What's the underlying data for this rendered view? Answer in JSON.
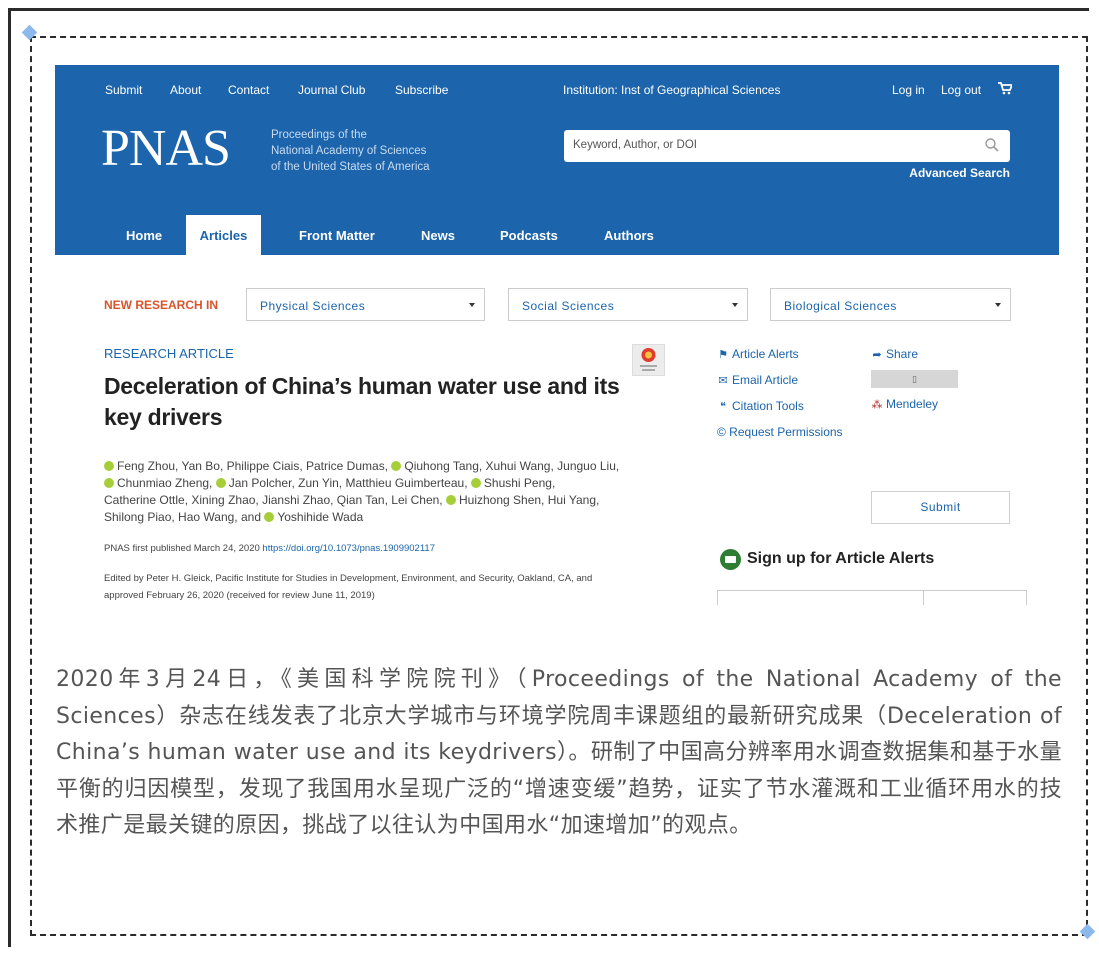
{
  "topnav": {
    "links": [
      "Submit",
      "About",
      "Contact",
      "Journal Club",
      "Subscribe"
    ],
    "institution": "Institution: Inst of Geographical Sciences",
    "login": "Log in",
    "logout": "Log out"
  },
  "logo": {
    "text": "PNAS",
    "sub1": "Proceedings of the",
    "sub2": "National Academy of Sciences",
    "sub3": "of the United States of America"
  },
  "search": {
    "placeholder": "Keyword, Author, or DOI",
    "advanced": "Advanced Search"
  },
  "mainnav": {
    "tabs": [
      "Home",
      "Articles",
      "Front Matter",
      "News",
      "Podcasts",
      "Authors"
    ],
    "active": "Articles"
  },
  "new_research": {
    "label": "NEW RESEARCH IN",
    "options": [
      "Physical Sciences",
      "Social Sciences",
      "Biological Sciences"
    ]
  },
  "article": {
    "type": "RESEARCH ARTICLE",
    "title": "Deceleration of China’s human water use and its key drivers",
    "authors_line1_a": "Feng Zhou, Yan Bo, Philippe Ciais, Patrice Dumas,",
    "authors_line1_b": "Qiuhong Tang, Xuhui Wang, Junguo Liu,",
    "authors_line2_a": "Chunmiao Zheng,",
    "authors_line2_b": "Jan Polcher, Zun Yin, Matthieu Guimberteau,",
    "authors_line2_c": "Shushi Peng,",
    "authors_line3_a": "Catherine Ottle, Xining Zhao, Jianshi Zhao, Qian Tan, Lei Chen,",
    "authors_line3_b": "Huizhong Shen, Hui Yang,",
    "authors_line4_a": "Shilong Piao, Hao Wang, and",
    "authors_line4_b": "Yoshihide Wada",
    "pub_prefix": "PNAS first published March 24, 2020",
    "doi": "https://doi.org/10.1073/pnas.1909902117",
    "edited_line1": "Edited by Peter H. Gleick, Pacific Institute for Studies in Development, Environment, and Security, Oakland, CA, and",
    "edited_line2": "approved February 26, 2020 (received for review June 11, 2019)"
  },
  "tools": {
    "article_alerts": "Article Alerts",
    "email_article": "Email Article",
    "citation_tools": "Citation Tools",
    "request_permissions": "© Request Permissions",
    "share": "Share",
    "mendeley": "Mendeley",
    "submit": "Submit",
    "signup_title": "Sign up for Article Alerts"
  },
  "caption": {
    "text": "2020年3月24日，《美国科学院院刊》（Proceedings of the National Academy of the Sciences）杂志在线发表了北京大学城市与环境学院周丰课题组的最新研究成果（Deceleration of China’s human water use and its keydrivers）。研制了中国高分辨率用水调查数据集和基于水量平衡的归因模型，发现了我国用水呈现广泛的“增速变缓”趋势，证实了节水灌溉和工业循环用水的技术推广是最关键的原因，挑战了以往认为中国用水“加速增加”的观点。"
  },
  "colors": {
    "pnas_blue": "#1c64ab",
    "new_research_red": "#d9542b",
    "orcid_green": "#a6ce39",
    "diamond": "#8db8ec"
  }
}
